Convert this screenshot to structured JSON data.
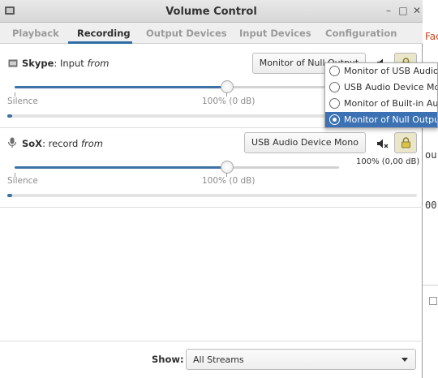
{
  "window": {
    "title": "Volume Control"
  },
  "tabs": [
    {
      "label": "Playback",
      "active": false
    },
    {
      "label": "Recording",
      "active": true
    },
    {
      "label": "Output Devices",
      "active": false
    },
    {
      "label": "Input Devices",
      "active": false
    },
    {
      "label": "Configuration",
      "active": false
    }
  ],
  "streams": [
    {
      "app": "Skype",
      "separator": ":",
      "desc": " Input ",
      "from": "from",
      "device_button": "Monitor of Null Output",
      "scale_left": "Silence",
      "scale_mid": "100% (0 dB)",
      "volume_percent": 100,
      "level_fraction": 0.0
    },
    {
      "app": "SoX",
      "separator": ":",
      "desc": " record ",
      "from": "from",
      "device_button": "USB Audio Device Mono",
      "scale_left": "Silence",
      "scale_mid": "100% (0 dB)",
      "db_readout": "100% (0,00 dB)",
      "volume_percent": 100,
      "level_fraction": 0.0
    }
  ],
  "popup": {
    "items": [
      {
        "label": "Monitor of USB Audio Device Mono",
        "selected": false
      },
      {
        "label": "USB Audio Device Mono",
        "selected": false
      },
      {
        "label": "Monitor of Built-in Audio",
        "selected": false
      },
      {
        "label": "Monitor of Null Output",
        "selected": true
      }
    ]
  },
  "footer": {
    "show_label": "Show:",
    "show_value": "All Streams"
  },
  "background_app": {
    "red_text": "Fac",
    "line1": "ou",
    "line2": "00"
  },
  "colors": {
    "accent": "#3c72a4",
    "selection": "#3c72b4",
    "lock_bg": "#e9e6c9"
  },
  "icons": [
    "app-icon",
    "microphone-icon",
    "speaker-muted-icon",
    "lock-icon",
    "chevron-down-icon"
  ]
}
